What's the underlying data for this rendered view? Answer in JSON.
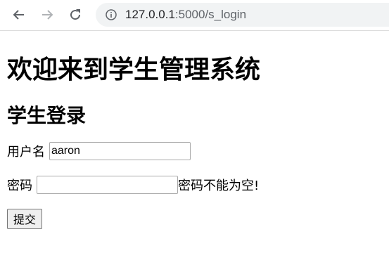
{
  "browser": {
    "url_host": "127.0.0.1",
    "url_path": ":5000/s_login",
    "icons": {
      "back": "back-arrow-icon",
      "forward": "forward-arrow-icon",
      "reload": "reload-icon",
      "info": "info-icon"
    }
  },
  "page": {
    "title": "欢迎来到学生管理系统",
    "subtitle": "学生登录",
    "form": {
      "username_label": "用户名",
      "username_value": "aaron",
      "password_label": "密码",
      "password_value": "",
      "error_message": "密码不能为空!",
      "submit_label": "提交"
    }
  },
  "colors": {
    "omnibox_bg": "#f1f3f4",
    "disabled_icon": "#b0b3b6",
    "icon": "#5f6368"
  }
}
